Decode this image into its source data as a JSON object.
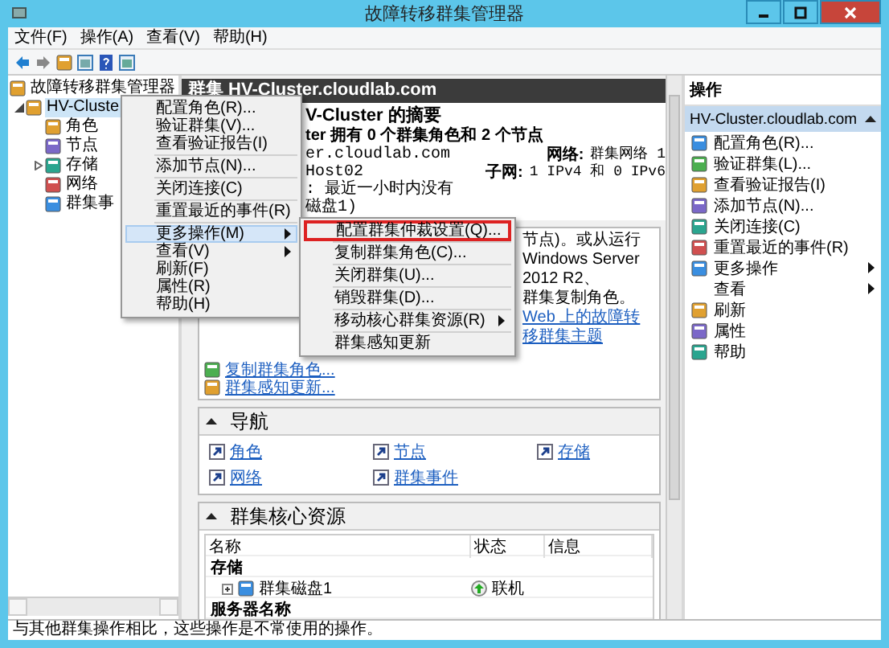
{
  "window": {
    "title": "故障转移群集管理器"
  },
  "menu_bar": [
    "文件(F)",
    "操作(A)",
    "查看(V)",
    "帮助(H)"
  ],
  "tree": [
    {
      "label": "故障转移群集管理器",
      "selected": false,
      "children": [
        {
          "label": "HV-Cluste",
          "selected": true,
          "expanded": true,
          "children": [
            {
              "label": "角色",
              "selected": false
            },
            {
              "label": "节点",
              "selected": false
            },
            {
              "label": "存储",
              "selected": false,
              "expanded": false
            },
            {
              "label": "网络",
              "selected": false
            },
            {
              "label": "群集事",
              "selected": false
            }
          ]
        }
      ]
    }
  ],
  "center": {
    "header": "群集 HV-Cluster.cloudlab.com",
    "summary": {
      "title": "V-Cluster 的摘要",
      "subtitle": "ter 拥有 0 个群集角色和 2 个节点",
      "lines": [
        "er.cloudlab.com",
        "Host02",
        ": 最近一小时内没有",
        "磁盘1)"
      ],
      "facts": [
        {
          "label": "网络:",
          "value": "群集网络 1"
        },
        {
          "label": "子网:",
          "value": "1 IPv4 和 0 IPv6"
        }
      ]
    },
    "configure": {
      "lines": [
        "节点)。或从运行 Windows Server 2012 R2、",
        "群集复制角色。"
      ],
      "link": "Web 上的故障转移群集主题",
      "links": [
        "复制群集角色...",
        "群集感知更新..."
      ]
    },
    "navigation": {
      "title": "导航",
      "expanded": true,
      "links": [
        "角色",
        "节点",
        "存储",
        "网络",
        "群集事件"
      ]
    },
    "core_resources": {
      "title": "群集核心资源",
      "expanded": true,
      "columns": [
        "名称",
        "状态",
        "信息"
      ],
      "rows": [
        {
          "kind": "group",
          "name": "存储"
        },
        {
          "kind": "item",
          "name": "群集磁盘1",
          "status": "联机"
        },
        {
          "kind": "group",
          "name": "服务器名称"
        }
      ]
    }
  },
  "actions": {
    "title": "操作",
    "group": "HV-Cluster.cloudlab.com",
    "expanded": true,
    "items": [
      {
        "label": "配置角色(R)...",
        "submenu": false
      },
      {
        "label": "验证群集(L)...",
        "submenu": false
      },
      {
        "label": "查看验证报告(I)",
        "submenu": false
      },
      {
        "label": "添加节点(N)...",
        "submenu": false
      },
      {
        "label": "关闭连接(C)",
        "submenu": false
      },
      {
        "label": "重置最近的事件(R)",
        "submenu": false
      },
      {
        "label": "更多操作",
        "submenu": true
      },
      {
        "label": "查看",
        "submenu": true
      },
      {
        "label": "刷新",
        "submenu": false
      },
      {
        "label": "属性",
        "submenu": false
      },
      {
        "label": "帮助",
        "submenu": false
      }
    ]
  },
  "context_menu": {
    "items": [
      {
        "kind": "item",
        "label": "配置角色(R)...",
        "selected": false,
        "submenu": false
      },
      {
        "kind": "item",
        "label": "验证群集(V)...",
        "selected": false,
        "submenu": false
      },
      {
        "kind": "item",
        "label": "查看验证报告(I)",
        "selected": false,
        "submenu": false
      },
      {
        "kind": "separator"
      },
      {
        "kind": "item",
        "label": "添加节点(N)...",
        "selected": false,
        "submenu": false
      },
      {
        "kind": "separator"
      },
      {
        "kind": "item",
        "label": "关闭连接(C)",
        "selected": false,
        "submenu": false
      },
      {
        "kind": "separator"
      },
      {
        "kind": "item",
        "label": "重置最近的事件(R)",
        "selected": false,
        "submenu": false
      },
      {
        "kind": "separator"
      },
      {
        "kind": "item",
        "label": "更多操作(M)",
        "selected": true,
        "submenu": true
      },
      {
        "kind": "item",
        "label": "查看(V)",
        "selected": false,
        "submenu": true
      },
      {
        "kind": "item",
        "label": "刷新(F)",
        "selected": false,
        "submenu": false
      },
      {
        "kind": "item",
        "label": "属性(R)",
        "selected": false,
        "submenu": false
      },
      {
        "kind": "item",
        "label": "帮助(H)",
        "selected": false,
        "submenu": false
      }
    ]
  },
  "submenu": {
    "items": [
      {
        "label": "配置群集仲裁设置(Q)...",
        "marked": true,
        "submenu": false
      },
      {
        "label": "复制群集角色(C)...",
        "marked": false,
        "submenu": false
      },
      {
        "label": "关闭群集(U)...",
        "marked": false,
        "submenu": false
      },
      {
        "label": "销毁群集(D)...",
        "marked": false,
        "submenu": false
      },
      {
        "label": "移动核心群集资源(R)",
        "marked": false,
        "submenu": true
      },
      {
        "label": "群集感知更新",
        "marked": false,
        "submenu": false
      }
    ]
  },
  "status_bar": "与其他群集操作相比，这些操作是不常使用的操作。"
}
